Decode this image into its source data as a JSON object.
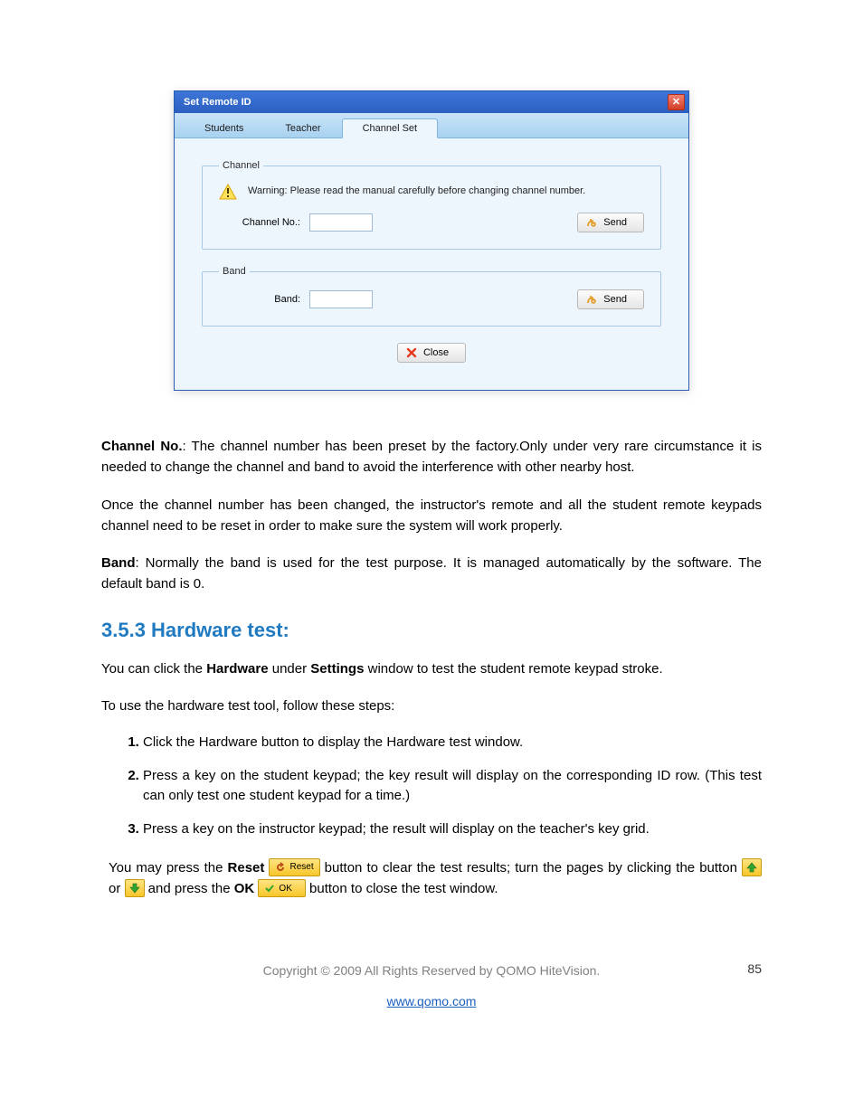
{
  "dialog": {
    "title": "Set Remote ID",
    "tabs": [
      "Students",
      "Teacher",
      "Channel Set"
    ],
    "active_tab": 2,
    "channel": {
      "legend": "Channel",
      "warning": "Warning: Please read the manual carefully before changing channel number.",
      "label": "Channel No.:",
      "value": "",
      "send": "Send"
    },
    "band": {
      "legend": "Band",
      "label": "Band:",
      "value": "",
      "send": "Send"
    },
    "close": "Close"
  },
  "body": {
    "p1_bold": "Channel No.",
    "p1_rest": ": The channel number has been preset by the factory.Only under very rare circumstance it is needed to change the channel and band to avoid the interference with other nearby host.",
    "p2": "Once the channel number has been changed, the instructor's remote and all the student remote keypads channel need to be reset in order to make sure the system will work properly.",
    "p3_bold": "Band",
    "p3_rest": ": Normally the band is used for the test purpose. It is managed automatically by the software. The default band is 0.",
    "section_title": "3.5.3 Hardware test:",
    "p4_a": "You can click the ",
    "p4_b1": "Hardware",
    "p4_b": " under ",
    "p4_b2": "Settings",
    "p4_c": " window to test the student remote keypad stroke.",
    "p5": "To use the hardware test tool, follow these steps:",
    "steps": [
      {
        "pre": "Click the ",
        "bold": "Hardware",
        "post": " button to display the Hardware test window."
      },
      {
        "text": "Press a key on the student keypad; the key result will display on the corresponding ID row. (This test can only test one student keypad for a time.)"
      },
      {
        "text": "Press a key on the instructor keypad; the result will display on the teacher's key grid."
      }
    ],
    "last": {
      "a": "You may press the ",
      "reset_bold": "Reset",
      "reset_chip": "Reset",
      "b": " button to clear the test results; turn the pages by clicking the button ",
      "or": " or ",
      "c": " and press the ",
      "ok_bold": "OK",
      "ok_chip": "OK",
      "d": " button to close the test window."
    }
  },
  "footer": {
    "copyright": "Copyright © 2009 All Rights Reserved by QOMO HiteVision.",
    "url": "www.qomo.com",
    "page": "85"
  }
}
